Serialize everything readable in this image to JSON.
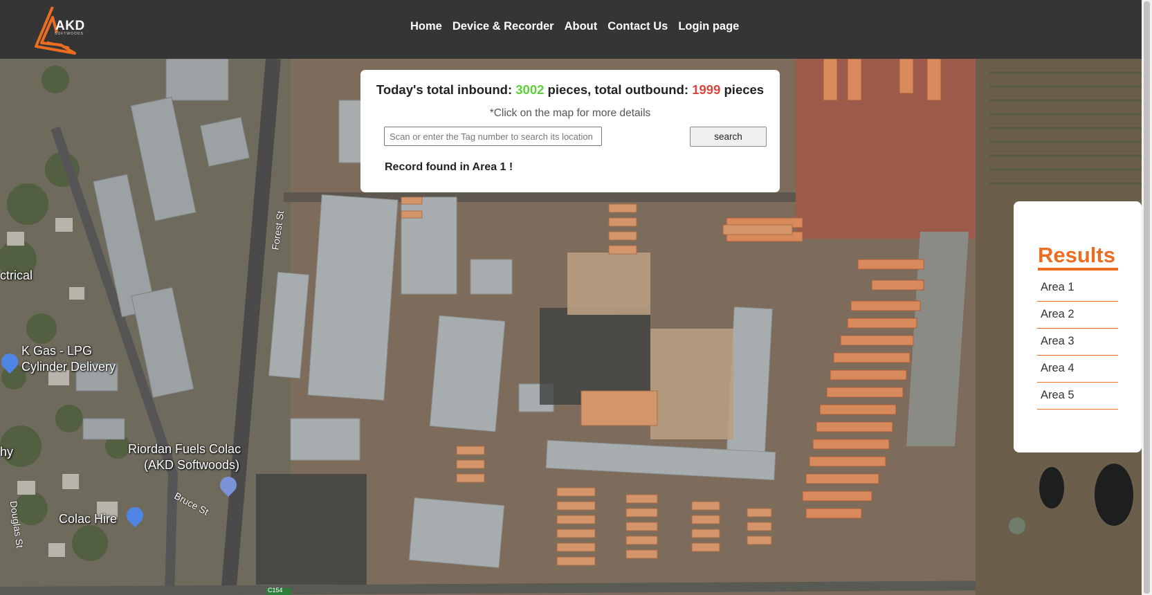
{
  "brand": {
    "name": "AKD",
    "sub": "SOFTWOODS"
  },
  "nav": {
    "items": [
      "Home",
      "Device & Recorder",
      "About",
      "Contact Us",
      "Login page"
    ]
  },
  "summary": {
    "prefix": "Today's total inbound: ",
    "inbound": "3002",
    "mid": " pieces, total outbound: ",
    "outbound": "1999",
    "suffix": " pieces",
    "hint": "*Click on the map for more details"
  },
  "search": {
    "placeholder": "Scan or enter the Tag number to search its location",
    "value": "",
    "button": "search",
    "result": "Record found in Area 1 !"
  },
  "results": {
    "title": "Results",
    "areas": [
      "Area 1",
      "Area 2",
      "Area 3",
      "Area 4",
      "Area 5"
    ]
  },
  "map": {
    "labels": {
      "electrical": "ctrical",
      "kgas_line1": "K Gas - LPG",
      "kgas_line2": "Cylinder Delivery",
      "riordan_line1": "Riordan Fuels Colac",
      "riordan_line2": "(AKD Softwoods)",
      "colac_hire": "Colac Hire",
      "left_edge": "hy",
      "forest_st": "Forest St",
      "bruce_st": "Bruce St",
      "douglas_st": "Douglas St",
      "road_badge": "C154"
    }
  },
  "colors": {
    "navbar": "#353535",
    "accent": "#ec6d21",
    "inbound": "#5fcf3a",
    "outbound": "#d9463f"
  }
}
